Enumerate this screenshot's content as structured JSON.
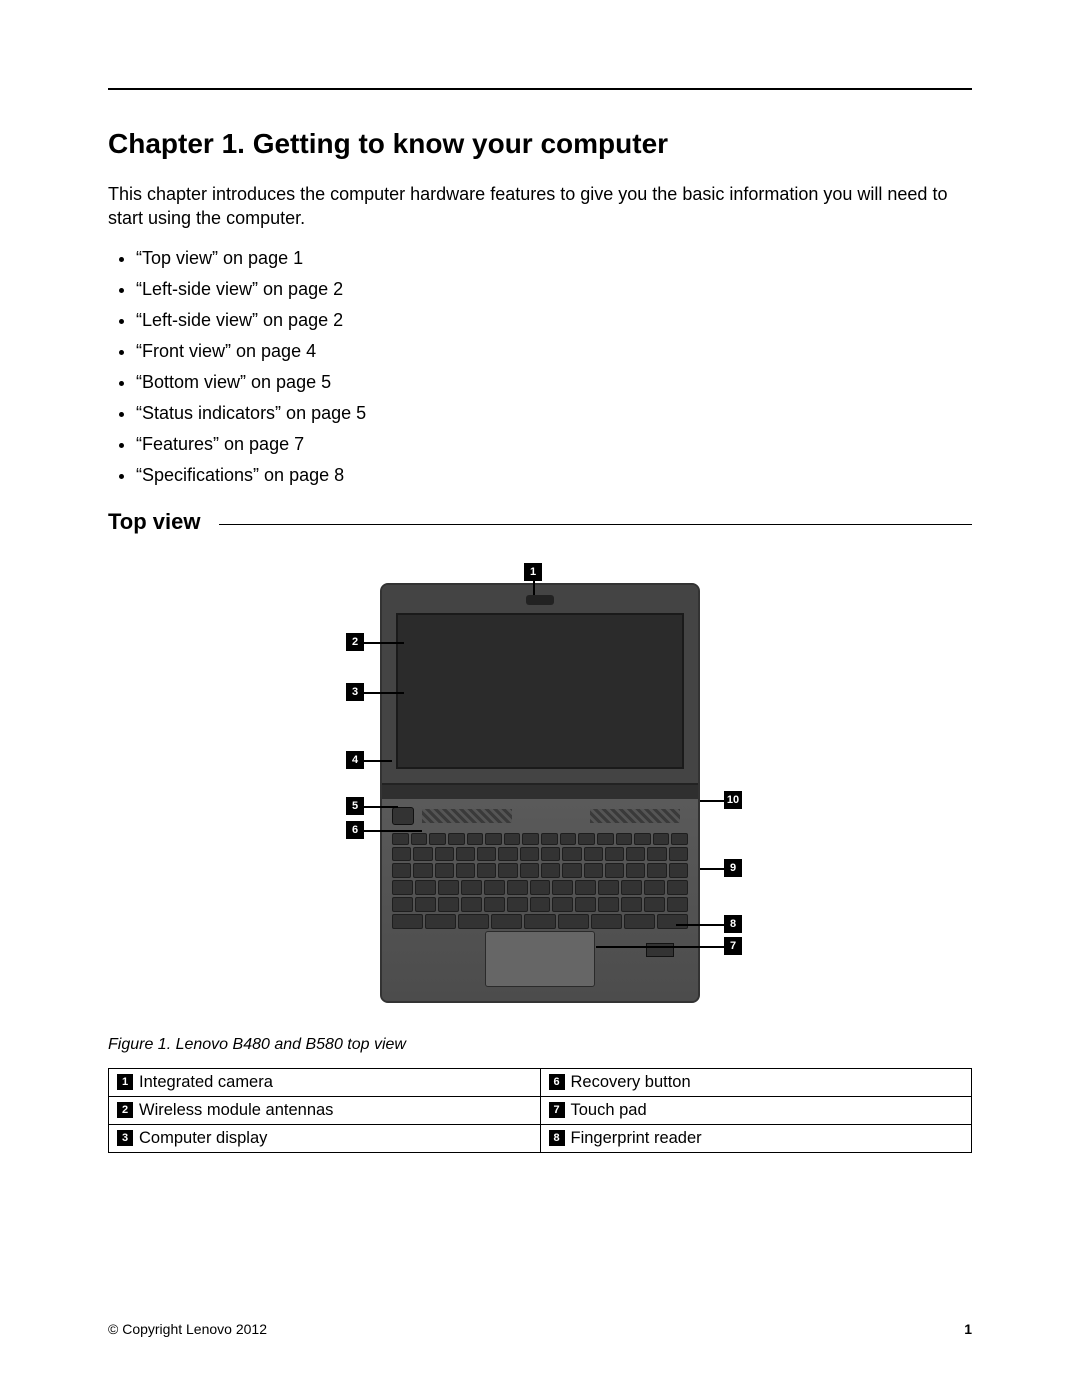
{
  "chapter_title": "Chapter 1.  Getting to know your computer",
  "intro": "This chapter introduces the computer hardware features to give you the basic information you will need to start using the computer.",
  "toc": [
    "“Top view” on page 1",
    "“Left-side view” on page 2",
    "“Left-side view” on page 2",
    "“Front view” on page 4",
    "“Bottom view” on page 5",
    "“Status indicators” on page 5",
    "“Features” on page 7",
    "“Specifications” on page 8"
  ],
  "section_title": "Top view",
  "figure": {
    "caption": "Figure 1.  Lenovo B480 and B580 top view",
    "callouts": [
      "1",
      "2",
      "3",
      "4",
      "5",
      "6",
      "7",
      "8",
      "9",
      "10"
    ]
  },
  "legend": [
    {
      "num": "1",
      "label": "Integrated camera"
    },
    {
      "num": "2",
      "label": "Wireless module antennas"
    },
    {
      "num": "3",
      "label": "Computer display"
    },
    {
      "num": "6",
      "label": "Recovery button"
    },
    {
      "num": "7",
      "label": "Touch pad"
    },
    {
      "num": "8",
      "label": "Fingerprint reader"
    }
  ],
  "footer": {
    "copyright": "© Copyright Lenovo 2012",
    "page": "1"
  }
}
